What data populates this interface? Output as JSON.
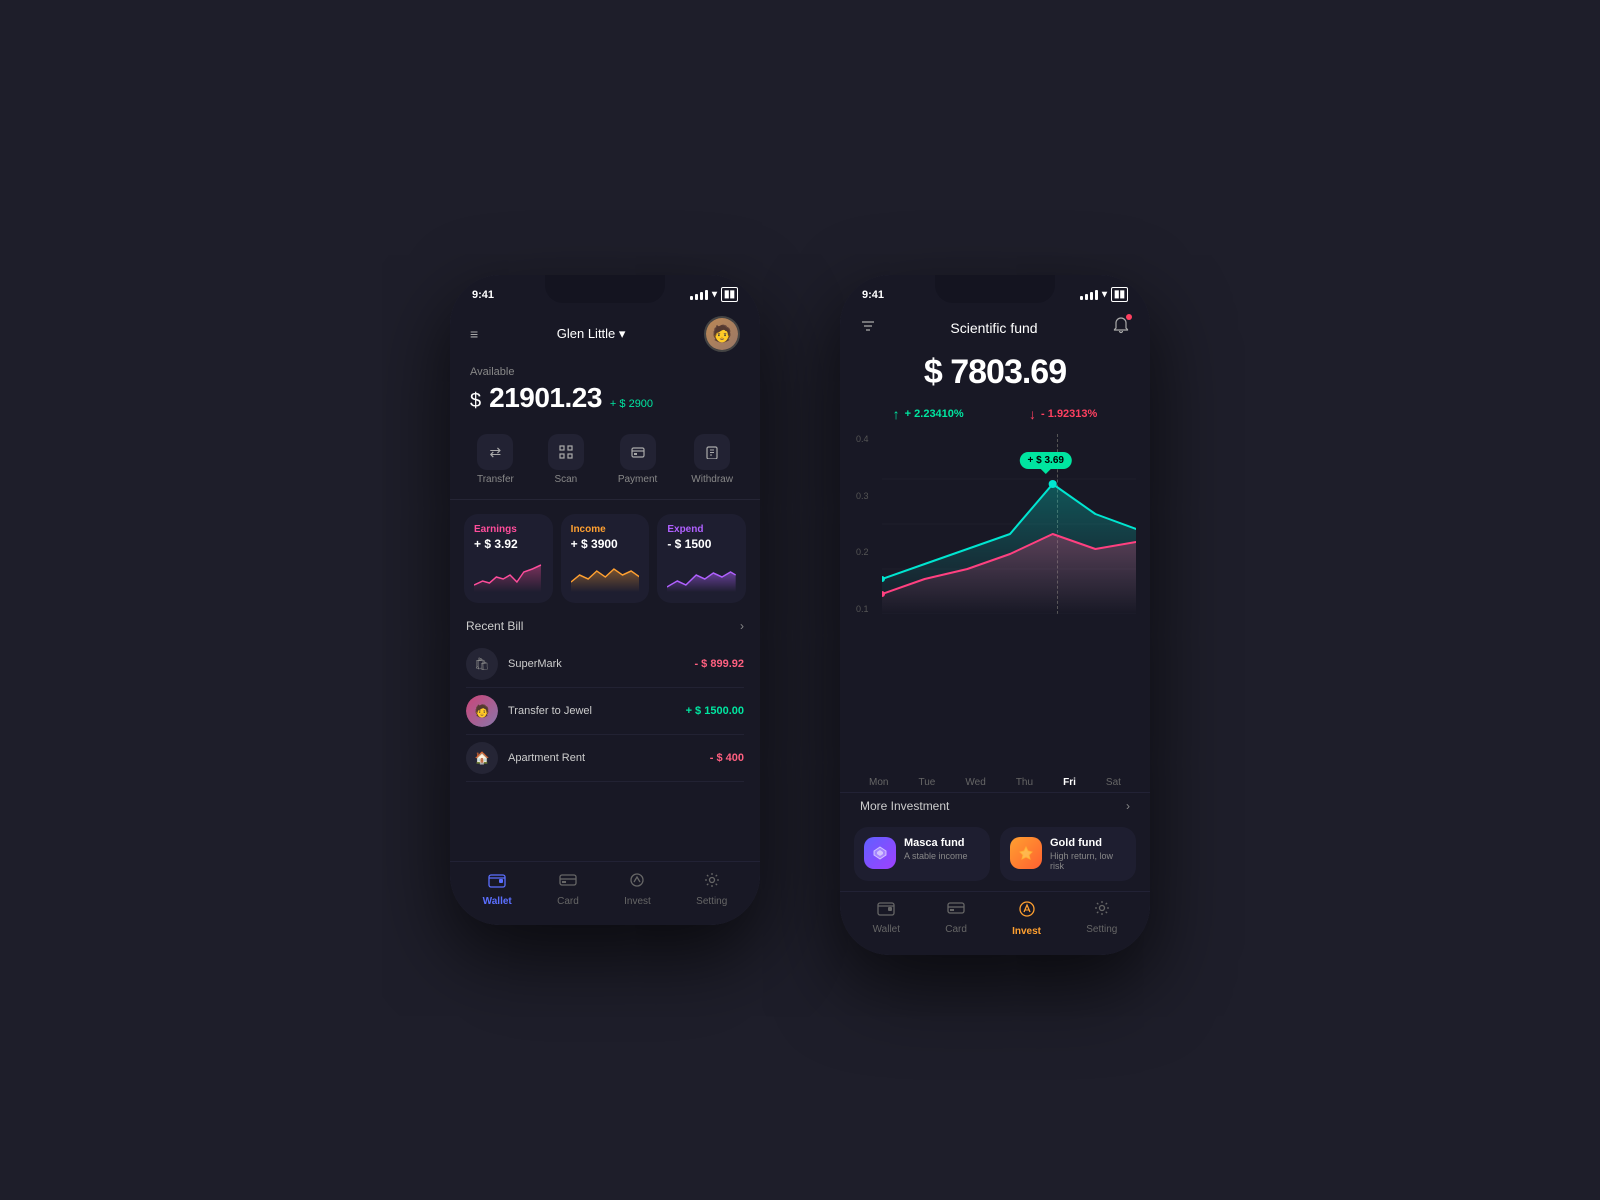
{
  "phone1": {
    "status": {
      "time": "9:41"
    },
    "header": {
      "user": "Glen Little ▾",
      "avatar": "👤"
    },
    "balance": {
      "label": "Available",
      "currency": "$",
      "amount": "21901.23",
      "change": "+ $ 2900"
    },
    "actions": [
      {
        "icon": "⇄",
        "label": "Transfer"
      },
      {
        "icon": "⊡",
        "label": "Scan"
      },
      {
        "icon": "▦",
        "label": "Payment"
      },
      {
        "icon": "⬦",
        "label": "Withdraw"
      }
    ],
    "stats": [
      {
        "label": "Earnings",
        "value": "+ $ 3.92",
        "type": "earnings"
      },
      {
        "label": "Income",
        "value": "+ $ 3900",
        "type": "income"
      },
      {
        "label": "Expend",
        "value": "- $ 1500",
        "type": "expend"
      }
    ],
    "recent": {
      "title": "Recent Bill",
      "bills": [
        {
          "name": "SuperMark",
          "amount": "- $ 899.92",
          "type": "neg",
          "icon": "🛍"
        },
        {
          "name": "Transfer to Jewel",
          "amount": "+ $ 1500.00",
          "type": "pos",
          "icon": "👤"
        },
        {
          "name": "Apartment Rent",
          "amount": "- $ 400",
          "type": "neg",
          "icon": "🏠"
        }
      ]
    },
    "nav": [
      {
        "label": "Wallet",
        "icon": "▣",
        "active": true
      },
      {
        "label": "Card",
        "icon": "◫"
      },
      {
        "label": "Invest",
        "icon": "◈"
      },
      {
        "label": "Setting",
        "icon": "⚙"
      }
    ]
  },
  "phone2": {
    "status": {
      "time": "9:41"
    },
    "header": {
      "title": "Scientific fund"
    },
    "balance": {
      "currency": "$",
      "amount": "7803.69"
    },
    "changes": [
      {
        "direction": "up",
        "value": "+ 2.23410%"
      },
      {
        "direction": "down",
        "value": "- 1.92313%"
      }
    ],
    "chart": {
      "tooltip": "+ $ 3.69",
      "yLabels": [
        "0.4",
        "0.3",
        "0.2",
        "0.1"
      ],
      "days": [
        "Mon",
        "Tue",
        "Wed",
        "Thu",
        "Fri",
        "Sat"
      ],
      "activeDay": "Fri"
    },
    "more": {
      "label": "More Investment"
    },
    "funds": [
      {
        "name": "Masca fund",
        "desc": "A stable income",
        "type": "masca",
        "icon": "♦"
      },
      {
        "name": "Gold fund",
        "desc": "High return, low risk",
        "type": "gold",
        "icon": "◆"
      }
    ],
    "nav": [
      {
        "label": "Wallet",
        "icon": "▣"
      },
      {
        "label": "Card",
        "icon": "◫"
      },
      {
        "label": "Invest",
        "icon": "◈",
        "active": true
      },
      {
        "label": "Setting",
        "icon": "⚙"
      }
    ]
  }
}
